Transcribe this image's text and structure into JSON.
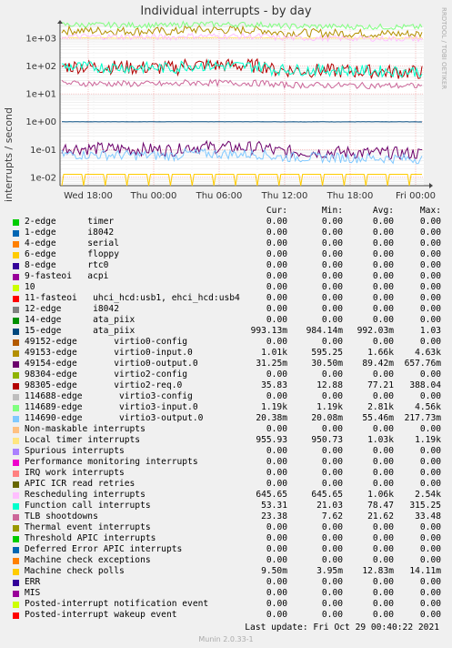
{
  "title": "Individual interrupts - by day",
  "watermark": "RRDTOOL / TOBI OETIKER",
  "legend_headers": {
    "cur": "Cur:",
    "min": "Min:",
    "avg": "Avg:",
    "max": "Max:"
  },
  "last_update": "Last update:  Fri Oct 29 00:40:22 2021",
  "version": "Munin 2.0.33-1",
  "chart_data": {
    "type": "line",
    "title": "Individual interrupts - by day",
    "ylabel": "interrupts / second",
    "yscale": "log",
    "ylim": [
      0.005,
      2500
    ],
    "y_ticks": [
      "1e-02",
      "1e-01",
      "1e+00",
      "1e+01",
      "1e+02",
      "1e+03"
    ],
    "x_ticks": [
      "Wed 18:00",
      "Thu 00:00",
      "Thu 06:00",
      "Thu 12:00",
      "Thu 18:00",
      "Fri 00:00"
    ],
    "grid": true,
    "series": [
      {
        "name": "2-edge      timer",
        "color": "#00cc00",
        "cur": "0.00",
        "min": "0.00",
        "avg": "0.00",
        "max": "0.00"
      },
      {
        "name": "1-edge      i8042",
        "color": "#0066b3",
        "cur": "0.00",
        "min": "0.00",
        "avg": "0.00",
        "max": "0.00"
      },
      {
        "name": "4-edge      serial",
        "color": "#ff8000",
        "cur": "0.00",
        "min": "0.00",
        "avg": "0.00",
        "max": "0.00"
      },
      {
        "name": "6-edge      floppy",
        "color": "#ffcc00",
        "cur": "0.00",
        "min": "0.00",
        "avg": "0.00",
        "max": "0.00"
      },
      {
        "name": "8-edge      rtc0",
        "color": "#330099",
        "cur": "0.00",
        "min": "0.00",
        "avg": "0.00",
        "max": "0.00"
      },
      {
        "name": "9-fasteoi   acpi",
        "color": "#990099",
        "cur": "0.00",
        "min": "0.00",
        "avg": "0.00",
        "max": "0.00"
      },
      {
        "name": "10",
        "color": "#ccff00",
        "cur": "0.00",
        "min": "0.00",
        "avg": "0.00",
        "max": "0.00"
      },
      {
        "name": "11-fasteoi   uhci_hcd:usb1, ehci_hcd:usb4",
        "color": "#ff0000",
        "cur": "0.00",
        "min": "0.00",
        "avg": "0.00",
        "max": "0.00"
      },
      {
        "name": "12-edge      i8042",
        "color": "#808080",
        "cur": "0.00",
        "min": "0.00",
        "avg": "0.00",
        "max": "0.00"
      },
      {
        "name": "14-edge      ata_piix",
        "color": "#008f00",
        "cur": "0.00",
        "min": "0.00",
        "avg": "0.00",
        "max": "0.00"
      },
      {
        "name": "15-edge      ata_piix",
        "color": "#00487d",
        "cur": "993.13m",
        "min": "984.14m",
        "avg": "992.03m",
        "max": "1.03"
      },
      {
        "name": "49152-edge       virtio0-config",
        "color": "#b35a00",
        "cur": "0.00",
        "min": "0.00",
        "avg": "0.00",
        "max": "0.00"
      },
      {
        "name": "49153-edge       virtio0-input.0",
        "color": "#b38f00",
        "cur": "1.01k",
        "min": "595.25",
        "avg": "1.66k",
        "max": "4.63k"
      },
      {
        "name": "49154-edge       virtio0-output.0",
        "color": "#6b006b",
        "cur": "31.25m",
        "min": "30.50m",
        "avg": "89.42m",
        "max": "657.76m"
      },
      {
        "name": "98304-edge       virtio2-config",
        "color": "#8fb300",
        "cur": "0.00",
        "min": "0.00",
        "avg": "0.00",
        "max": "0.00"
      },
      {
        "name": "98305-edge       virtio2-req.0",
        "color": "#b30000",
        "cur": "35.83",
        "min": "12.88",
        "avg": "77.21",
        "max": "388.04"
      },
      {
        "name": "114688-edge       virtio3-config",
        "color": "#bebebe",
        "cur": "0.00",
        "min": "0.00",
        "avg": "0.00",
        "max": "0.00"
      },
      {
        "name": "114689-edge       virtio3-input.0",
        "color": "#80ff80",
        "cur": "1.19k",
        "min": "1.19k",
        "avg": "2.81k",
        "max": "4.56k"
      },
      {
        "name": "114690-edge       virtio3-output.0",
        "color": "#80c9ff",
        "cur": "20.38m",
        "min": "20.08m",
        "avg": "55.46m",
        "max": "217.73m"
      },
      {
        "name": "Non-maskable interrupts",
        "color": "#ffc080",
        "cur": "0.00",
        "min": "0.00",
        "avg": "0.00",
        "max": "0.00"
      },
      {
        "name": "Local timer interrupts",
        "color": "#ffe680",
        "cur": "955.93",
        "min": "950.73",
        "avg": "1.03k",
        "max": "1.19k"
      },
      {
        "name": "Spurious interrupts",
        "color": "#aa80ff",
        "cur": "0.00",
        "min": "0.00",
        "avg": "0.00",
        "max": "0.00"
      },
      {
        "name": "Performance monitoring interrupts",
        "color": "#ee00cc",
        "cur": "0.00",
        "min": "0.00",
        "avg": "0.00",
        "max": "0.00"
      },
      {
        "name": "IRQ work interrupts",
        "color": "#ff8080",
        "cur": "0.00",
        "min": "0.00",
        "avg": "0.00",
        "max": "0.00"
      },
      {
        "name": "APIC ICR read retries",
        "color": "#666600",
        "cur": "0.00",
        "min": "0.00",
        "avg": "0.00",
        "max": "0.00"
      },
      {
        "name": "Rescheduling interrupts",
        "color": "#ffbfff",
        "cur": "645.65",
        "min": "645.65",
        "avg": "1.06k",
        "max": "2.54k"
      },
      {
        "name": "Function call interrupts",
        "color": "#00ffcc",
        "cur": "53.31",
        "min": "21.03",
        "avg": "78.47",
        "max": "315.25"
      },
      {
        "name": "TLB shootdowns",
        "color": "#cc6699",
        "cur": "23.38",
        "min": "7.62",
        "avg": "21.62",
        "max": "33.48"
      },
      {
        "name": "Thermal event interrupts",
        "color": "#999900",
        "cur": "0.00",
        "min": "0.00",
        "avg": "0.00",
        "max": "0.00"
      },
      {
        "name": "Threshold APIC interrupts",
        "color": "#00cc00",
        "cur": "0.00",
        "min": "0.00",
        "avg": "0.00",
        "max": "0.00"
      },
      {
        "name": "Deferred Error APIC interrupts",
        "color": "#0066b3",
        "cur": "0.00",
        "min": "0.00",
        "avg": "0.00",
        "max": "0.00"
      },
      {
        "name": "Machine check exceptions",
        "color": "#ff8000",
        "cur": "0.00",
        "min": "0.00",
        "avg": "0.00",
        "max": "0.00"
      },
      {
        "name": "Machine check polls",
        "color": "#ffcc00",
        "cur": "9.50m",
        "min": "3.95m",
        "avg": "12.83m",
        "max": "14.11m"
      },
      {
        "name": "ERR",
        "color": "#330099",
        "cur": "0.00",
        "min": "0.00",
        "avg": "0.00",
        "max": "0.00"
      },
      {
        "name": "MIS",
        "color": "#990099",
        "cur": "0.00",
        "min": "0.00",
        "avg": "0.00",
        "max": "0.00"
      },
      {
        "name": "Posted-interrupt notification event",
        "color": "#ccff00",
        "cur": "0.00",
        "min": "0.00",
        "avg": "0.00",
        "max": "0.00"
      },
      {
        "name": "Posted-interrupt wakeup event",
        "color": "#ff0000",
        "cur": "0.00",
        "min": "0.00",
        "avg": "0.00",
        "max": "0.00"
      }
    ]
  }
}
